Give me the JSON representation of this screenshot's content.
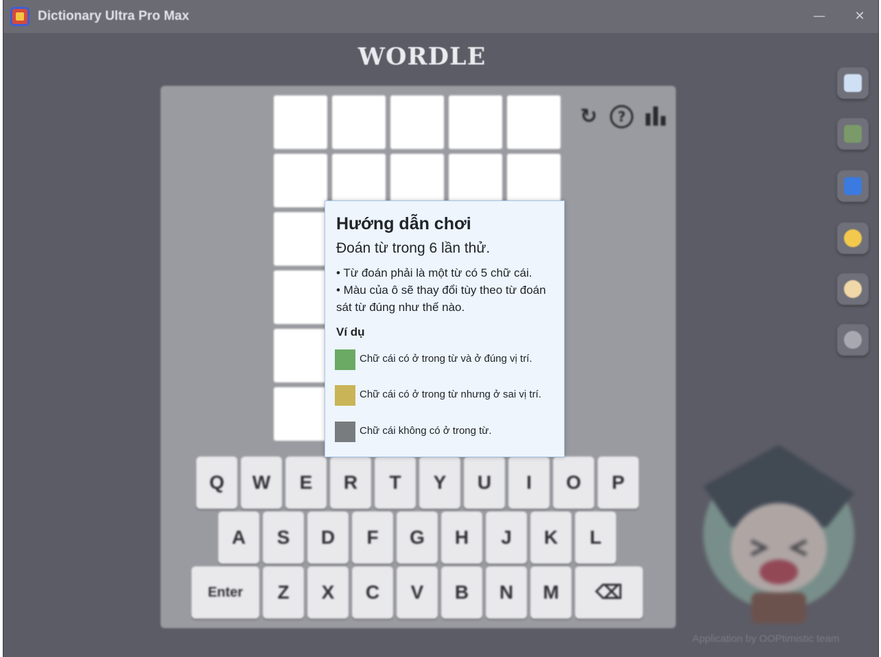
{
  "window": {
    "title": "Dictionary Ultra Pro Max",
    "minimize_glyph": "—",
    "close_glyph": "✕"
  },
  "game": {
    "heading": "WORDLE",
    "grid_rows": 6,
    "grid_cols": 5,
    "tools": {
      "reset_glyph": "↻",
      "help_glyph": "?",
      "stats_glyph": "▮"
    }
  },
  "keyboard": {
    "row1": [
      "Q",
      "W",
      "E",
      "R",
      "T",
      "Y",
      "U",
      "I",
      "O",
      "P"
    ],
    "row2": [
      "A",
      "S",
      "D",
      "F",
      "G",
      "H",
      "J",
      "K",
      "L"
    ],
    "row3": [
      "Enter",
      "Z",
      "X",
      "C",
      "V",
      "B",
      "N",
      "M",
      "⌫"
    ]
  },
  "sidebar": {
    "items": [
      {
        "name": "dictionary-icon",
        "color": "#cfe0f5"
      },
      {
        "name": "grid-icon",
        "color": "#7a9a6a"
      },
      {
        "name": "translate-icon",
        "color": "#3b7ae0"
      },
      {
        "name": "theme-icon",
        "color": "#f2c94c"
      },
      {
        "name": "tools-icon",
        "color": "#f0d8a8"
      },
      {
        "name": "info-icon",
        "color": "#a8a9b0"
      }
    ]
  },
  "modal": {
    "title": "Hướng dẫn chơi",
    "subtitle": "Đoán từ trong 6 lần thử.",
    "rule1": "• Từ đoán phải là một từ có 5 chữ cái.",
    "rule2": "• Màu của ô sẽ thay đổi tùy theo từ đoán sát từ đúng như thế nào.",
    "example_title": "Ví dụ",
    "legend": [
      {
        "color": "#6aaa64",
        "text": "Chữ cái có ở trong từ và ở đúng vị trí."
      },
      {
        "color": "#c9b458",
        "text": "Chữ cái có ở trong từ nhưng ở sai vị trí."
      },
      {
        "color": "#787c7e",
        "text": "Chữ cái không có ở trong từ."
      }
    ]
  },
  "footer": {
    "credit": "Application by OOPtimistic team"
  }
}
